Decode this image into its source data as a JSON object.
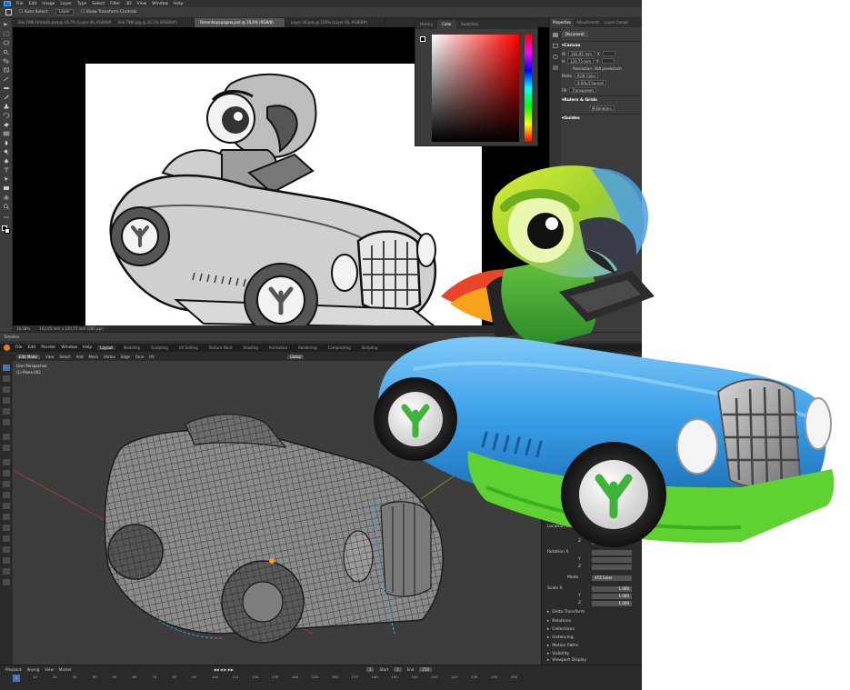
{
  "photoshop": {
    "menu": [
      "File",
      "Edit",
      "Image",
      "Layer",
      "Type",
      "Select",
      "Filter",
      "3D",
      "View",
      "Window",
      "Help"
    ],
    "options": {
      "auto_select": "Auto-Select",
      "layer": "Layer",
      "transform_controls": "Show Transform Controls"
    },
    "tabs": [
      "Elie TINK Drmkids.psd @ 16,7% (Layer 46, RGB/8#)",
      "Elie TINK.jpg @ 16,7% (RGB/8#)",
      "Desenhopapagaio.psd @ 16,6% (RGB/8)",
      "Layer 46.psb @ 100% (Layer 46, RGB/8#)"
    ],
    "active_tab": 2,
    "status": {
      "zoom": "16,58%",
      "size": "162,95 mm x 120,75 mm (300 ppi)"
    },
    "timeline_label": "Timeline",
    "color_panel": {
      "tabs": [
        "History",
        "Color",
        "Swatches"
      ],
      "active": 1
    },
    "properties": {
      "tabs": [
        "Properties",
        "Adjustments",
        "Layer Comps"
      ],
      "document_label": "Document",
      "canvas_heading": "Canvas",
      "w": "162,95 mm",
      "h": "120,75 mm",
      "w_label": "W",
      "h_label": "H",
      "x_label": "X",
      "y_label": "Y",
      "resolution": "Resolution: 300 pixels/inch",
      "mode_label": "Mode",
      "mode": "RGB Color",
      "depth": "8 Bits/Channel",
      "fill_label": "Fill",
      "fill": "Transparent",
      "rulers_heading": "Rulers & Grids",
      "units": "Millimeters",
      "guides_heading": "Guides"
    },
    "colors": {
      "ui": "#535353",
      "dark": "#323232",
      "logo": "#31a8ff"
    }
  },
  "blender": {
    "menu": [
      "File",
      "Edit",
      "Render",
      "Window",
      "Help"
    ],
    "workspaces": [
      "Layout",
      "Modeling",
      "Sculpting",
      "UV Editing",
      "Texture Paint",
      "Shading",
      "Animation",
      "Rendering",
      "Compositing",
      "Scripting"
    ],
    "active_workspace": 0,
    "header": {
      "mode": "Edit Mode",
      "items": [
        "View",
        "Select",
        "Add",
        "Mesh",
        "Vertex",
        "Edge",
        "Face",
        "UV"
      ],
      "orientation": "Global"
    },
    "viewport": {
      "view": "User Perspective",
      "object": "(1) Plane.002"
    },
    "transform": {
      "location_x": "Location X",
      "y": "Y",
      "z": "Z",
      "rotation_x": "Rotation X",
      "mode_label": "Mode",
      "mode": "XYZ Euler",
      "scale_x": "Scale X",
      "scale_x_val": "1.000",
      "scale_y_val": "1.000",
      "scale_z_val": "1.000"
    },
    "sections": [
      "Delta Transform",
      "Relations",
      "Collections",
      "Instancing",
      "Motion Paths",
      "Visibility",
      "Viewport Display",
      "Custom Properties"
    ],
    "timeline": {
      "menu": [
        "Playback",
        "Keying",
        "View",
        "Marker"
      ],
      "current": "1",
      "start_label": "Start",
      "start": "1",
      "end_label": "End",
      "end": "250",
      "ticks": [
        "1",
        "10",
        "20",
        "30",
        "40",
        "50",
        "60",
        "70",
        "80",
        "90",
        "100",
        "110",
        "120",
        "130",
        "140",
        "150",
        "160",
        "170",
        "180",
        "190",
        "200",
        "210",
        "220",
        "230",
        "240",
        "250"
      ]
    },
    "colors": {
      "logo": "#e87d0d",
      "accent": "#4772b3"
    }
  },
  "render_colors": {
    "car": "#3aa0e8",
    "bumper": "#5fd130",
    "parrot_body": "#3ea93a",
    "parrot_head": "#b6d52a",
    "beak": "#3a3d47"
  }
}
